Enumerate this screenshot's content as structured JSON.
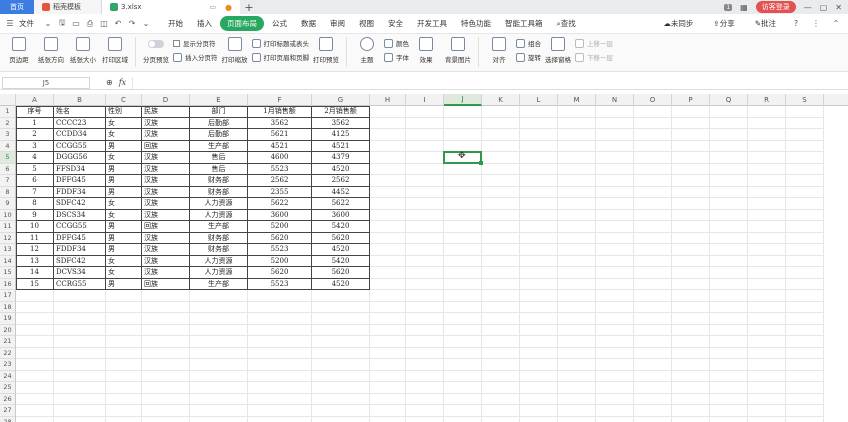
{
  "titlebar": {
    "tabs": [
      {
        "label": "首页"
      },
      {
        "label": "稻壳模板"
      },
      {
        "label": "3.xlsx"
      }
    ],
    "badge": "1",
    "login_label": "访客登录"
  },
  "menubar": {
    "file_label": "文件",
    "items": [
      "开始",
      "插入",
      "页面布局",
      "公式",
      "数据",
      "审阅",
      "视图",
      "安全",
      "开发工具",
      "特色功能",
      "智能工具箱"
    ],
    "active_index": 2,
    "search_label": "查找",
    "sync_label": "未同步",
    "share_label": "分享",
    "comment_label": "批注"
  },
  "ribbon": {
    "margins": "页边距",
    "orientation": "纸张方向",
    "size": "纸张大小",
    "print_area": "打印区域",
    "page_preview": "分页预览",
    "show_page_break": "显示分页符",
    "insert_page_break": "插入分页符",
    "print_scale": "打印缩放",
    "print_titles": "打印标题或表头",
    "header_footer": "打印页眉和页脚",
    "print_preview": "打印预览",
    "theme": "主题",
    "colors": "颜色",
    "fonts": "字体",
    "effects": "效果",
    "background": "背景图片",
    "align": "对齐",
    "group": "组合",
    "rotate": "旋转",
    "select_pane": "选择窗格",
    "bring_forward": "上移一层",
    "send_backward": "下移一层"
  },
  "formulabar": {
    "name_box": "J5",
    "fx": "fx",
    "formula": ""
  },
  "sheet": {
    "columns": [
      "A",
      "B",
      "C",
      "D",
      "E",
      "F",
      "G",
      "H",
      "I",
      "J",
      "K",
      "L",
      "M",
      "N",
      "O",
      "P",
      "Q",
      "R",
      "S"
    ],
    "selected_column": "J",
    "selected_row": 5,
    "row_count": 28,
    "header": [
      "序号",
      "姓名",
      "性别",
      "民族",
      "部门",
      "1月销售额",
      "2月销售额"
    ],
    "rows": [
      [
        "1",
        "CCCC23",
        "女",
        "汉族",
        "后勤部",
        "3562",
        "3562"
      ],
      [
        "2",
        "CCDD34",
        "女",
        "汉族",
        "后勤部",
        "5621",
        "4125"
      ],
      [
        "3",
        "CCGG55",
        "男",
        "回族",
        "生产部",
        "4521",
        "4521"
      ],
      [
        "4",
        "DGGG56",
        "女",
        "汉族",
        "售后",
        "4600",
        "4379"
      ],
      [
        "5",
        "FFSD34",
        "男",
        "汉族",
        "售后",
        "5523",
        "4520"
      ],
      [
        "6",
        "DFFG45",
        "男",
        "汉族",
        "财务部",
        "2562",
        "2562"
      ],
      [
        "7",
        "FDDF34",
        "男",
        "汉族",
        "财务部",
        "2355",
        "4452"
      ],
      [
        "8",
        "SDFC42",
        "女",
        "汉族",
        "人力资源",
        "5622",
        "5622"
      ],
      [
        "9",
        "DSCS34",
        "女",
        "汉族",
        "人力资源",
        "3600",
        "3600"
      ],
      [
        "10",
        "CCGG55",
        "男",
        "回族",
        "生产部",
        "5200",
        "5420"
      ],
      [
        "11",
        "DFFG45",
        "男",
        "汉族",
        "财务部",
        "5620",
        "5620"
      ],
      [
        "12",
        "FDDF34",
        "男",
        "汉族",
        "财务部",
        "5523",
        "4520"
      ],
      [
        "13",
        "SDFC42",
        "女",
        "汉族",
        "人力资源",
        "5200",
        "5420"
      ],
      [
        "14",
        "DCVS34",
        "女",
        "汉族",
        "人力资源",
        "5620",
        "5620"
      ],
      [
        "15",
        "CCRG55",
        "男",
        "回族",
        "生产部",
        "5523",
        "4520"
      ]
    ]
  }
}
